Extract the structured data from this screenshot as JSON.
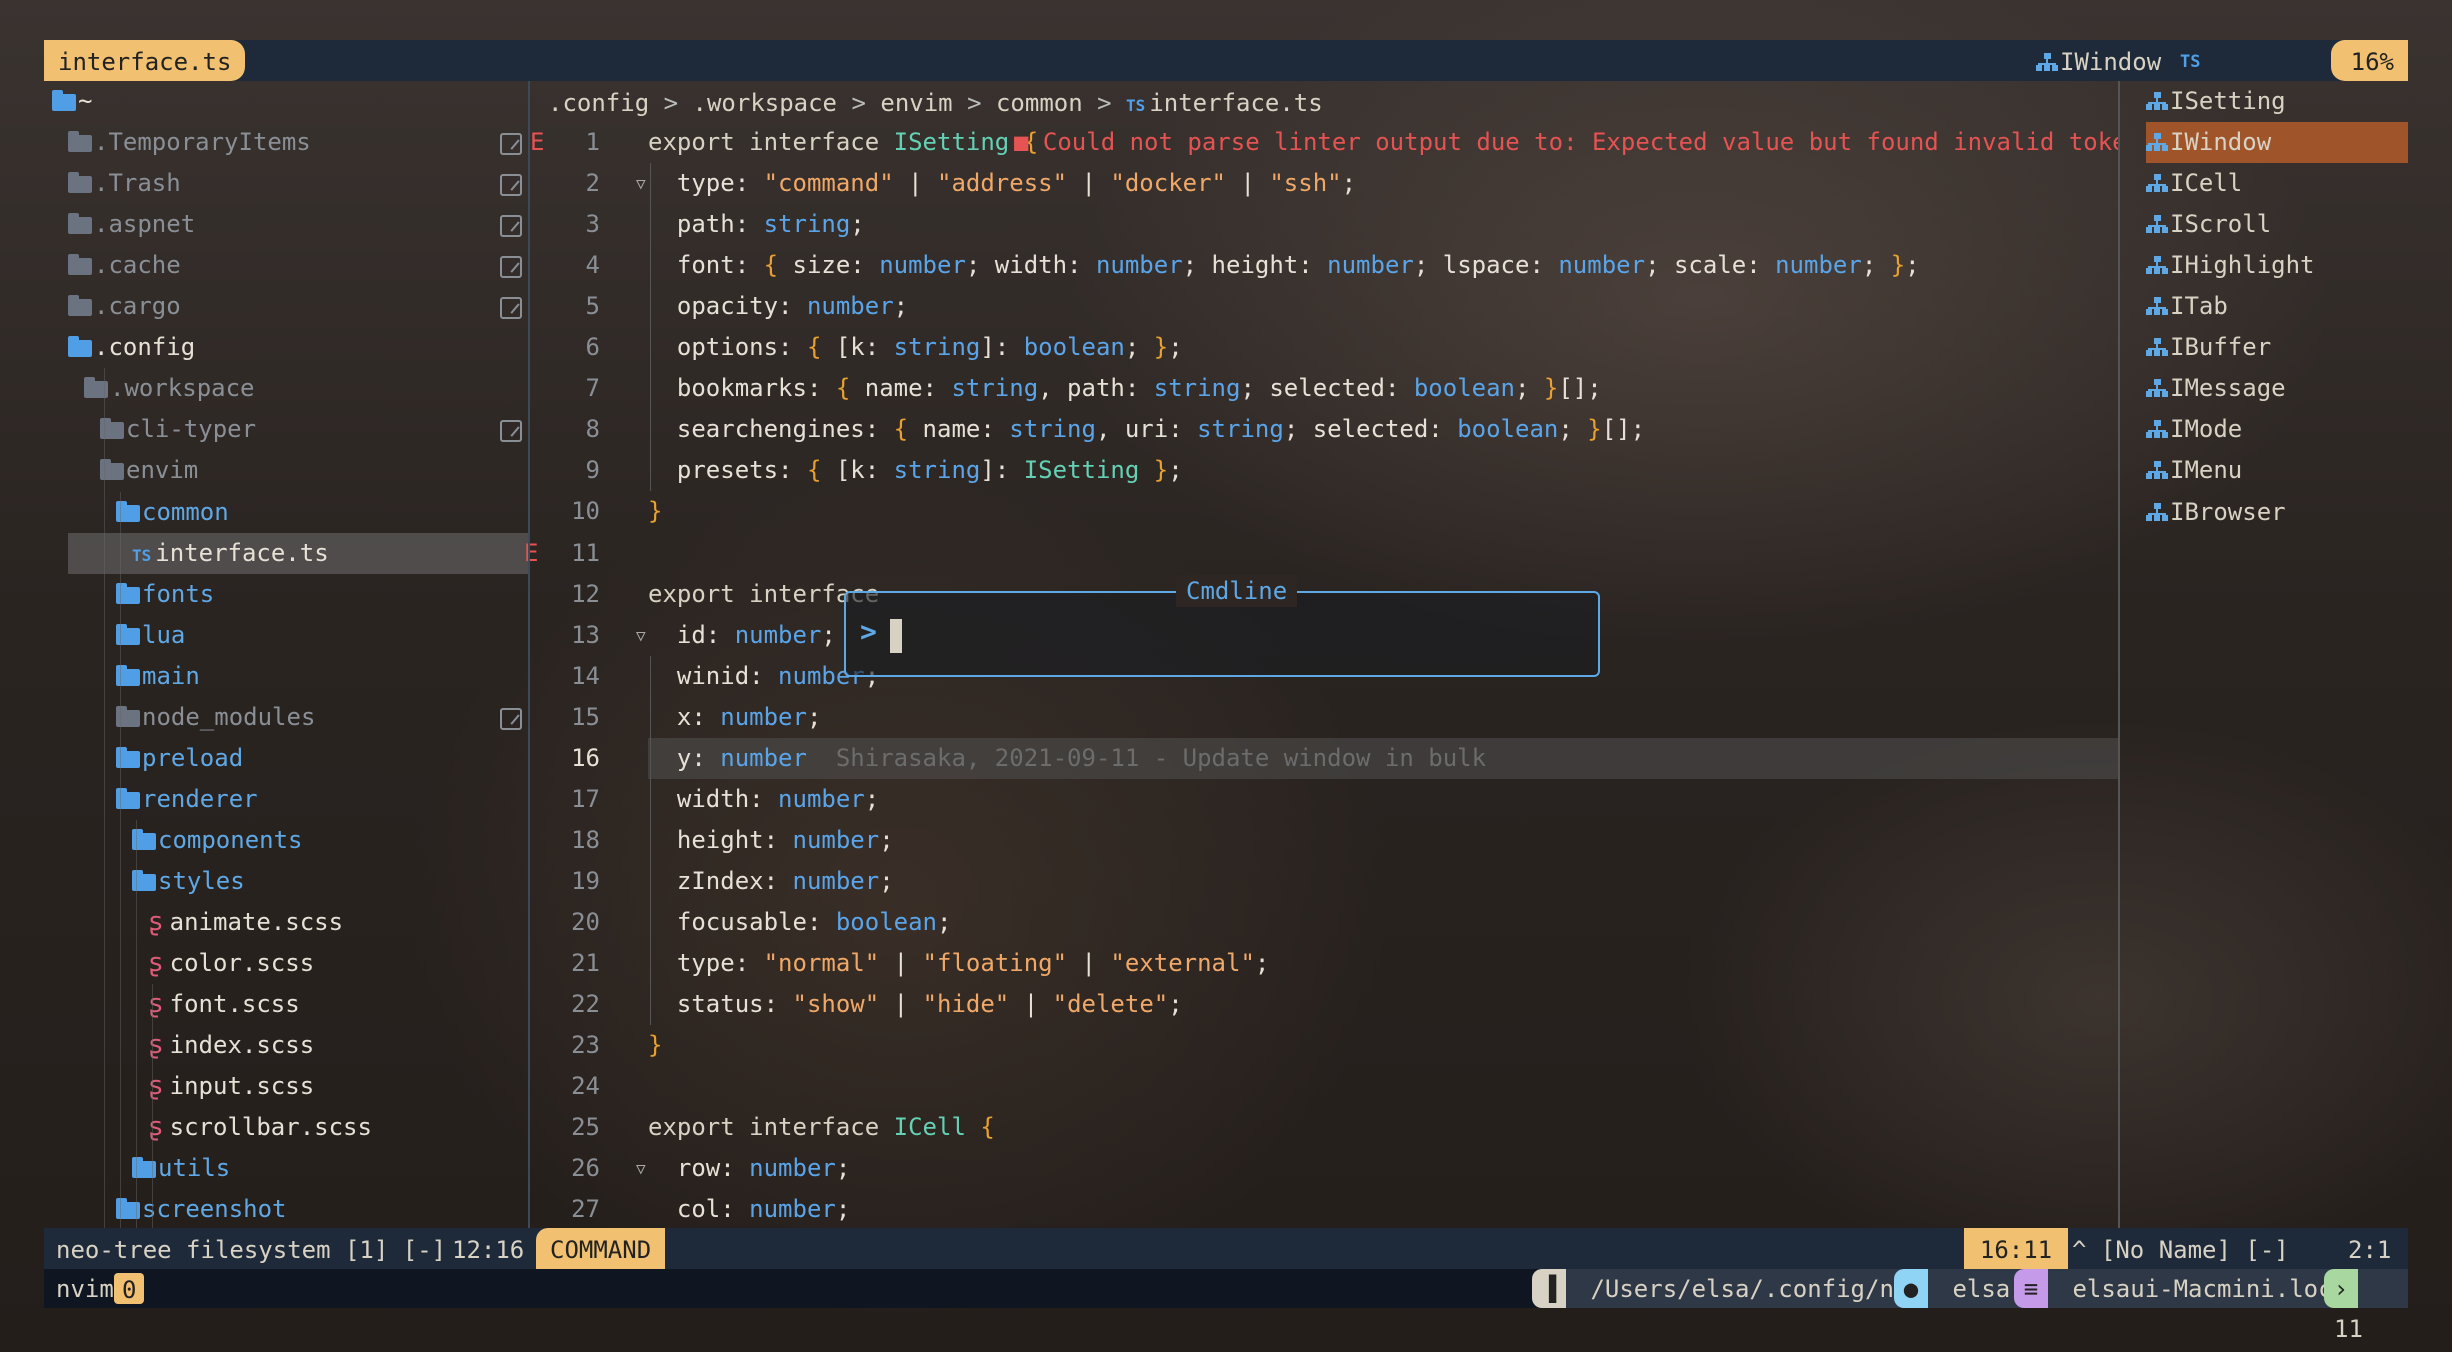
{
  "tabline": {
    "active_tab": "interface.ts",
    "symbol": "IWindow",
    "filetype": "TS",
    "percent": "16%"
  },
  "tree": {
    "rows": [
      {
        "label": "~",
        "depth": 0,
        "kind": "dir-open",
        "muted": false
      },
      {
        "label": ".TemporaryItems",
        "depth": 1,
        "kind": "dir",
        "muted": true,
        "check": true
      },
      {
        "label": ".Trash",
        "depth": 1,
        "kind": "dir",
        "muted": true,
        "check": true
      },
      {
        "label": ".aspnet",
        "depth": 1,
        "kind": "dir",
        "muted": true,
        "check": true
      },
      {
        "label": ".cache",
        "depth": 1,
        "kind": "dir",
        "muted": true,
        "check": true
      },
      {
        "label": ".cargo",
        "depth": 1,
        "kind": "dir",
        "muted": true,
        "check": true
      },
      {
        "label": ".config",
        "depth": 1,
        "kind": "dir-open",
        "muted": false
      },
      {
        "label": ".workspace",
        "depth": 2,
        "kind": "dir-open",
        "muted": true
      },
      {
        "label": "cli-typer",
        "depth": 3,
        "kind": "dir",
        "muted": true,
        "check": true
      },
      {
        "label": "envim",
        "depth": 3,
        "kind": "dir-open",
        "muted": true
      },
      {
        "label": "common",
        "depth": 4,
        "kind": "dir-open-blue",
        "muted": false
      },
      {
        "label": "interface.ts",
        "depth": 5,
        "kind": "ts",
        "muted": false,
        "selected": true,
        "error": "E"
      },
      {
        "label": "fonts",
        "depth": 4,
        "kind": "dir-blue",
        "muted": false
      },
      {
        "label": "lua",
        "depth": 4,
        "kind": "dir-blue",
        "muted": false
      },
      {
        "label": "main",
        "depth": 4,
        "kind": "dir-blue",
        "muted": false
      },
      {
        "label": "node_modules",
        "depth": 4,
        "kind": "dir",
        "muted": true,
        "check": true
      },
      {
        "label": "preload",
        "depth": 4,
        "kind": "dir-blue",
        "muted": false
      },
      {
        "label": "renderer",
        "depth": 4,
        "kind": "dir-open-blue",
        "muted": false
      },
      {
        "label": "components",
        "depth": 5,
        "kind": "dir-blue",
        "muted": false
      },
      {
        "label": "styles",
        "depth": 5,
        "kind": "dir-open-blue",
        "muted": false
      },
      {
        "label": "animate.scss",
        "depth": 6,
        "kind": "scss",
        "muted": false
      },
      {
        "label": "color.scss",
        "depth": 6,
        "kind": "scss",
        "muted": false
      },
      {
        "label": "font.scss",
        "depth": 6,
        "kind": "scss",
        "muted": false
      },
      {
        "label": "index.scss",
        "depth": 6,
        "kind": "scss",
        "muted": false
      },
      {
        "label": "input.scss",
        "depth": 6,
        "kind": "scss",
        "muted": false
      },
      {
        "label": "scrollbar.scss",
        "depth": 6,
        "kind": "scss",
        "muted": false
      },
      {
        "label": "utils",
        "depth": 5,
        "kind": "dir-blue",
        "muted": false
      },
      {
        "label": "screenshot",
        "depth": 4,
        "kind": "dir-blue",
        "muted": false
      }
    ]
  },
  "breadcrumb": {
    "parts": [
      ".config",
      ".workspace",
      "envim",
      "common"
    ],
    "file_icon": "TS",
    "file": "interface.ts",
    "sep": ">"
  },
  "editor": {
    "sign": "E",
    "diagnostic": "■ Could not parse linter output due to: Expected value but found invalid token at charac",
    "blame": "Shirasaka, 2021-09-11 - Update window in bulk",
    "current_line": 16,
    "lines": [
      {
        "n": "1",
        "t": [
          [
            "kw",
            "export interface "
          ],
          [
            "iface",
            "ISetting "
          ],
          [
            "brace",
            "{"
          ]
        ]
      },
      {
        "n": "2",
        "fold": true,
        "t": [
          [
            "prop",
            "  type: "
          ],
          [
            "str",
            "\"command\""
          ],
          [
            "prop",
            " | "
          ],
          [
            "str",
            "\"address\""
          ],
          [
            "prop",
            " | "
          ],
          [
            "str",
            "\"docker\""
          ],
          [
            "prop",
            " | "
          ],
          [
            "str",
            "\"ssh\""
          ],
          [
            "prop",
            ";"
          ]
        ]
      },
      {
        "n": "3",
        "t": [
          [
            "prop",
            "  path: "
          ],
          [
            "typ",
            "string"
          ],
          [
            "prop",
            ";"
          ]
        ]
      },
      {
        "n": "4",
        "t": [
          [
            "prop",
            "  font: "
          ],
          [
            "brace",
            "{"
          ],
          [
            "prop",
            " size: "
          ],
          [
            "typ",
            "number"
          ],
          [
            "prop",
            "; width: "
          ],
          [
            "typ",
            "number"
          ],
          [
            "prop",
            "; height: "
          ],
          [
            "typ",
            "number"
          ],
          [
            "prop",
            "; lspace: "
          ],
          [
            "typ",
            "number"
          ],
          [
            "prop",
            "; scale: "
          ],
          [
            "typ",
            "number"
          ],
          [
            "prop",
            "; "
          ],
          [
            "brace",
            "}"
          ],
          [
            "prop",
            ";"
          ]
        ]
      },
      {
        "n": "5",
        "t": [
          [
            "prop",
            "  opacity: "
          ],
          [
            "typ",
            "number"
          ],
          [
            "prop",
            ";"
          ]
        ]
      },
      {
        "n": "6",
        "t": [
          [
            "prop",
            "  options: "
          ],
          [
            "brace",
            "{"
          ],
          [
            "prop",
            " [k: "
          ],
          [
            "typ",
            "string"
          ],
          [
            "prop",
            "]: "
          ],
          [
            "typ",
            "boolean"
          ],
          [
            "prop",
            "; "
          ],
          [
            "brace",
            "}"
          ],
          [
            "prop",
            ";"
          ]
        ]
      },
      {
        "n": "7",
        "t": [
          [
            "prop",
            "  bookmarks: "
          ],
          [
            "brace",
            "{"
          ],
          [
            "prop",
            " name: "
          ],
          [
            "typ",
            "string"
          ],
          [
            "prop",
            ", path: "
          ],
          [
            "typ",
            "string"
          ],
          [
            "prop",
            "; selected: "
          ],
          [
            "typ",
            "boolean"
          ],
          [
            "prop",
            "; "
          ],
          [
            "brace",
            "}"
          ],
          [
            "prop",
            "[];"
          ]
        ]
      },
      {
        "n": "8",
        "t": [
          [
            "prop",
            "  searchengines: "
          ],
          [
            "brace",
            "{"
          ],
          [
            "prop",
            " name: "
          ],
          [
            "typ",
            "string"
          ],
          [
            "prop",
            ", uri: "
          ],
          [
            "typ",
            "string"
          ],
          [
            "prop",
            "; selected: "
          ],
          [
            "typ",
            "boolean"
          ],
          [
            "prop",
            "; "
          ],
          [
            "brace",
            "}"
          ],
          [
            "prop",
            "[];"
          ]
        ]
      },
      {
        "n": "9",
        "t": [
          [
            "prop",
            "  presets: "
          ],
          [
            "brace",
            "{"
          ],
          [
            "prop",
            " [k: "
          ],
          [
            "typ",
            "string"
          ],
          [
            "prop",
            "]: "
          ],
          [
            "iface",
            "ISetting"
          ],
          [
            "prop",
            " "
          ],
          [
            "brace",
            "}"
          ],
          [
            "prop",
            ";"
          ]
        ]
      },
      {
        "n": "10",
        "t": [
          [
            "brace",
            "}"
          ]
        ]
      },
      {
        "n": "11",
        "t": []
      },
      {
        "n": "12",
        "t": [
          [
            "kw",
            "export interface"
          ]
        ]
      },
      {
        "n": "13",
        "fold": true,
        "t": [
          [
            "prop",
            "  id: "
          ],
          [
            "typ",
            "number"
          ],
          [
            "prop",
            ";"
          ]
        ]
      },
      {
        "n": "14",
        "t": [
          [
            "prop",
            "  winid: "
          ],
          [
            "typ",
            "number"
          ],
          [
            "prop",
            ";"
          ]
        ]
      },
      {
        "n": "15",
        "t": [
          [
            "prop",
            "  x: "
          ],
          [
            "typ",
            "number"
          ],
          [
            "prop",
            ";"
          ]
        ]
      },
      {
        "n": "16",
        "t": [
          [
            "prop",
            "  y: "
          ],
          [
            "typ",
            "number"
          ]
        ]
      },
      {
        "n": "17",
        "t": [
          [
            "prop",
            "  width: "
          ],
          [
            "typ",
            "number"
          ],
          [
            "prop",
            ";"
          ]
        ]
      },
      {
        "n": "18",
        "t": [
          [
            "prop",
            "  height: "
          ],
          [
            "typ",
            "number"
          ],
          [
            "prop",
            ";"
          ]
        ]
      },
      {
        "n": "19",
        "t": [
          [
            "prop",
            "  zIndex: "
          ],
          [
            "typ",
            "number"
          ],
          [
            "prop",
            ";"
          ]
        ]
      },
      {
        "n": "20",
        "t": [
          [
            "prop",
            "  focusable: "
          ],
          [
            "typ",
            "boolean"
          ],
          [
            "prop",
            ";"
          ]
        ]
      },
      {
        "n": "21",
        "t": [
          [
            "prop",
            "  type: "
          ],
          [
            "str",
            "\"normal\""
          ],
          [
            "prop",
            " | "
          ],
          [
            "str",
            "\"floating\""
          ],
          [
            "prop",
            " | "
          ],
          [
            "str",
            "\"external\""
          ],
          [
            "prop",
            ";"
          ]
        ]
      },
      {
        "n": "22",
        "t": [
          [
            "prop",
            "  status: "
          ],
          [
            "str",
            "\"show\""
          ],
          [
            "prop",
            " | "
          ],
          [
            "str",
            "\"hide\""
          ],
          [
            "prop",
            " | "
          ],
          [
            "str",
            "\"delete\""
          ],
          [
            "prop",
            ";"
          ]
        ]
      },
      {
        "n": "23",
        "t": [
          [
            "brace",
            "}"
          ]
        ]
      },
      {
        "n": "24",
        "t": []
      },
      {
        "n": "25",
        "t": [
          [
            "kw",
            "export interface "
          ],
          [
            "iface",
            "ICell "
          ],
          [
            "brace",
            "{"
          ]
        ]
      },
      {
        "n": "26",
        "fold": true,
        "t": [
          [
            "prop",
            "  row: "
          ],
          [
            "typ",
            "number"
          ],
          [
            "prop",
            ";"
          ]
        ]
      },
      {
        "n": "27",
        "t": [
          [
            "prop",
            "  col: "
          ],
          [
            "typ",
            "number"
          ],
          [
            "prop",
            ";"
          ]
        ]
      }
    ]
  },
  "outline": {
    "items": [
      "ISetting",
      "IWindow",
      "ICell",
      "IScroll",
      "IHighlight",
      "ITab",
      "IBuffer",
      "IMessage",
      "IMode",
      "IMenu",
      "IBrowser"
    ],
    "selected": "IWindow"
  },
  "cmdline": {
    "title": "Cmdline",
    "prompt": ">"
  },
  "status": {
    "tree_name": "neo-tree filesystem [1] [-]",
    "tree_pos": "12:16",
    "mode": "COMMAND",
    "cursor_pos": "16:11",
    "right_buffer": "^ [No Name] [-]",
    "right_pos": "2:1"
  },
  "tmux": {
    "session": "nvim",
    "window": "0",
    "path": "/Users/elsa/.config/nvim",
    "user": "elsa",
    "host": "elsaui-Macmini.local",
    "panes": "11"
  },
  "colors": {
    "accent": "#f1c070",
    "blue": "#5fa8e6",
    "error": "#e55353",
    "selection": "#a0542a"
  }
}
